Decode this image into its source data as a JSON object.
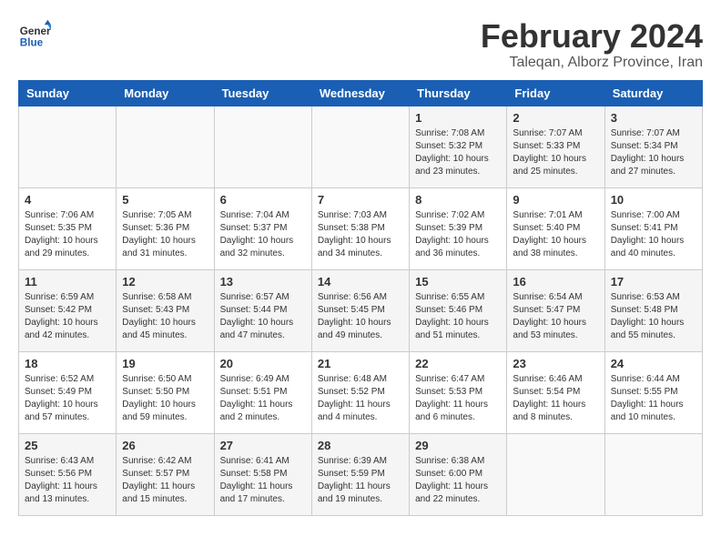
{
  "app": {
    "name_line1": "General",
    "name_line2": "Blue"
  },
  "header": {
    "title": "February 2024",
    "subtitle": "Taleqan, Alborz Province, Iran"
  },
  "days_of_week": [
    "Sunday",
    "Monday",
    "Tuesday",
    "Wednesday",
    "Thursday",
    "Friday",
    "Saturday"
  ],
  "weeks": [
    [
      {
        "day": "",
        "info": ""
      },
      {
        "day": "",
        "info": ""
      },
      {
        "day": "",
        "info": ""
      },
      {
        "day": "",
        "info": ""
      },
      {
        "day": "1",
        "info": "Sunrise: 7:08 AM\nSunset: 5:32 PM\nDaylight: 10 hours\nand 23 minutes."
      },
      {
        "day": "2",
        "info": "Sunrise: 7:07 AM\nSunset: 5:33 PM\nDaylight: 10 hours\nand 25 minutes."
      },
      {
        "day": "3",
        "info": "Sunrise: 7:07 AM\nSunset: 5:34 PM\nDaylight: 10 hours\nand 27 minutes."
      }
    ],
    [
      {
        "day": "4",
        "info": "Sunrise: 7:06 AM\nSunset: 5:35 PM\nDaylight: 10 hours\nand 29 minutes."
      },
      {
        "day": "5",
        "info": "Sunrise: 7:05 AM\nSunset: 5:36 PM\nDaylight: 10 hours\nand 31 minutes."
      },
      {
        "day": "6",
        "info": "Sunrise: 7:04 AM\nSunset: 5:37 PM\nDaylight: 10 hours\nand 32 minutes."
      },
      {
        "day": "7",
        "info": "Sunrise: 7:03 AM\nSunset: 5:38 PM\nDaylight: 10 hours\nand 34 minutes."
      },
      {
        "day": "8",
        "info": "Sunrise: 7:02 AM\nSunset: 5:39 PM\nDaylight: 10 hours\nand 36 minutes."
      },
      {
        "day": "9",
        "info": "Sunrise: 7:01 AM\nSunset: 5:40 PM\nDaylight: 10 hours\nand 38 minutes."
      },
      {
        "day": "10",
        "info": "Sunrise: 7:00 AM\nSunset: 5:41 PM\nDaylight: 10 hours\nand 40 minutes."
      }
    ],
    [
      {
        "day": "11",
        "info": "Sunrise: 6:59 AM\nSunset: 5:42 PM\nDaylight: 10 hours\nand 42 minutes."
      },
      {
        "day": "12",
        "info": "Sunrise: 6:58 AM\nSunset: 5:43 PM\nDaylight: 10 hours\nand 45 minutes."
      },
      {
        "day": "13",
        "info": "Sunrise: 6:57 AM\nSunset: 5:44 PM\nDaylight: 10 hours\nand 47 minutes."
      },
      {
        "day": "14",
        "info": "Sunrise: 6:56 AM\nSunset: 5:45 PM\nDaylight: 10 hours\nand 49 minutes."
      },
      {
        "day": "15",
        "info": "Sunrise: 6:55 AM\nSunset: 5:46 PM\nDaylight: 10 hours\nand 51 minutes."
      },
      {
        "day": "16",
        "info": "Sunrise: 6:54 AM\nSunset: 5:47 PM\nDaylight: 10 hours\nand 53 minutes."
      },
      {
        "day": "17",
        "info": "Sunrise: 6:53 AM\nSunset: 5:48 PM\nDaylight: 10 hours\nand 55 minutes."
      }
    ],
    [
      {
        "day": "18",
        "info": "Sunrise: 6:52 AM\nSunset: 5:49 PM\nDaylight: 10 hours\nand 57 minutes."
      },
      {
        "day": "19",
        "info": "Sunrise: 6:50 AM\nSunset: 5:50 PM\nDaylight: 10 hours\nand 59 minutes."
      },
      {
        "day": "20",
        "info": "Sunrise: 6:49 AM\nSunset: 5:51 PM\nDaylight: 11 hours\nand 2 minutes."
      },
      {
        "day": "21",
        "info": "Sunrise: 6:48 AM\nSunset: 5:52 PM\nDaylight: 11 hours\nand 4 minutes."
      },
      {
        "day": "22",
        "info": "Sunrise: 6:47 AM\nSunset: 5:53 PM\nDaylight: 11 hours\nand 6 minutes."
      },
      {
        "day": "23",
        "info": "Sunrise: 6:46 AM\nSunset: 5:54 PM\nDaylight: 11 hours\nand 8 minutes."
      },
      {
        "day": "24",
        "info": "Sunrise: 6:44 AM\nSunset: 5:55 PM\nDaylight: 11 hours\nand 10 minutes."
      }
    ],
    [
      {
        "day": "25",
        "info": "Sunrise: 6:43 AM\nSunset: 5:56 PM\nDaylight: 11 hours\nand 13 minutes."
      },
      {
        "day": "26",
        "info": "Sunrise: 6:42 AM\nSunset: 5:57 PM\nDaylight: 11 hours\nand 15 minutes."
      },
      {
        "day": "27",
        "info": "Sunrise: 6:41 AM\nSunset: 5:58 PM\nDaylight: 11 hours\nand 17 minutes."
      },
      {
        "day": "28",
        "info": "Sunrise: 6:39 AM\nSunset: 5:59 PM\nDaylight: 11 hours\nand 19 minutes."
      },
      {
        "day": "29",
        "info": "Sunrise: 6:38 AM\nSunset: 6:00 PM\nDaylight: 11 hours\nand 22 minutes."
      },
      {
        "day": "",
        "info": ""
      },
      {
        "day": "",
        "info": ""
      }
    ]
  ]
}
